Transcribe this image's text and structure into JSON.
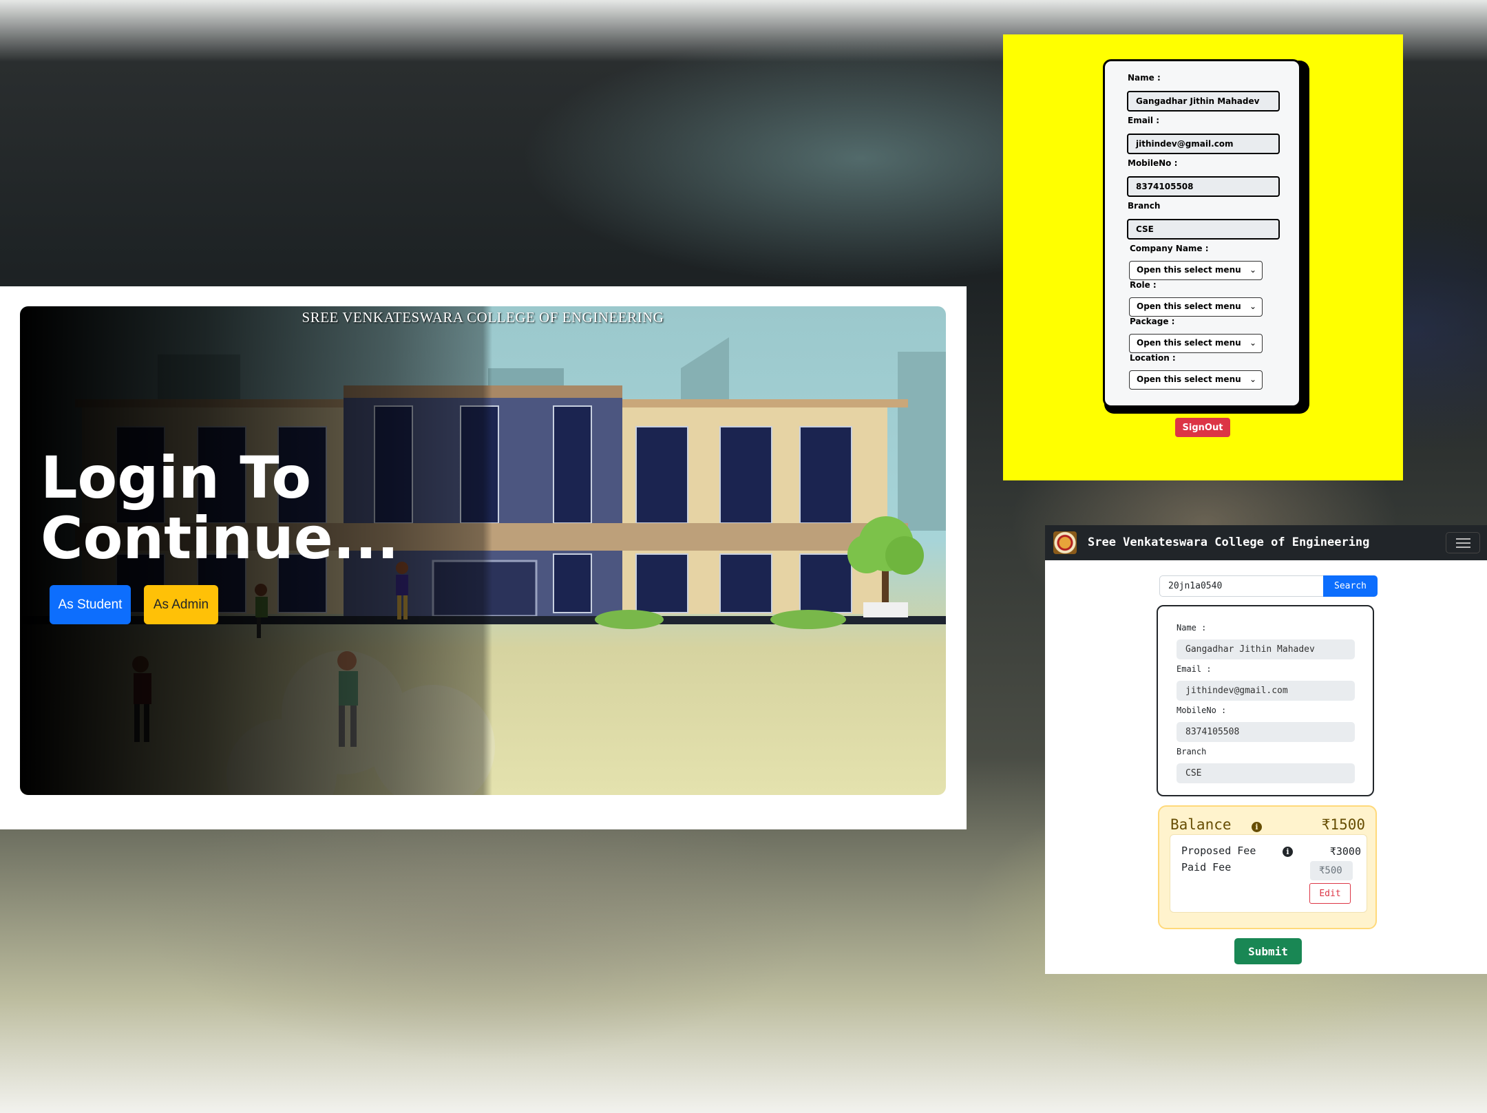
{
  "login": {
    "college_name": "SREE VENKATESWARA COLLEGE OF ENGINEERING",
    "heading_line1": "Login To",
    "heading_line2": "Continue...",
    "student_button": "As Student",
    "admin_button": "As Admin",
    "colors": {
      "student": "#0d6efd",
      "admin": "#ffc107"
    }
  },
  "admin_form": {
    "background": "#ffff00",
    "name_label": "Name :",
    "name_value": "Gangadhar  Jithin Mahadev",
    "email_label": "Email :",
    "email_value": "jithindev@gmail.com",
    "mobile_label": "MobileNo :",
    "mobile_value": "8374105508",
    "branch_label": "Branch",
    "branch_value": "CSE",
    "company_label": "Company Name :",
    "company_select": "Open this select menu",
    "role_label": "Role :",
    "role_select": "Open this select menu",
    "package_label": "Package :",
    "package_select": "Open this select menu",
    "location_label": "Location :",
    "location_select": "Open this select menu",
    "signout_button": "SignOut"
  },
  "fee_app": {
    "navbar": {
      "title": "Sree Venkateswara College of Engineering",
      "logo_icon": "college-logo",
      "menu_icon": "hamburger-icon"
    },
    "search": {
      "value": "20jn1a0540",
      "button": "Search"
    },
    "student": {
      "name_label": "Name :",
      "name_value": "Gangadhar  Jithin Mahadev",
      "email_label": "Email :",
      "email_value": "jithindev@gmail.com",
      "mobile_label": "MobileNo :",
      "mobile_value": "8374105508",
      "branch_label": "Branch",
      "branch_value": "CSE"
    },
    "balance": {
      "label": "Balance",
      "amount": "₹1500",
      "proposed_label": "Proposed Fee",
      "proposed_amount": "₹3000",
      "paid_label": "Paid Fee",
      "paid_value": "₹500",
      "edit_button": "Edit"
    },
    "submit_button": "Submit"
  }
}
